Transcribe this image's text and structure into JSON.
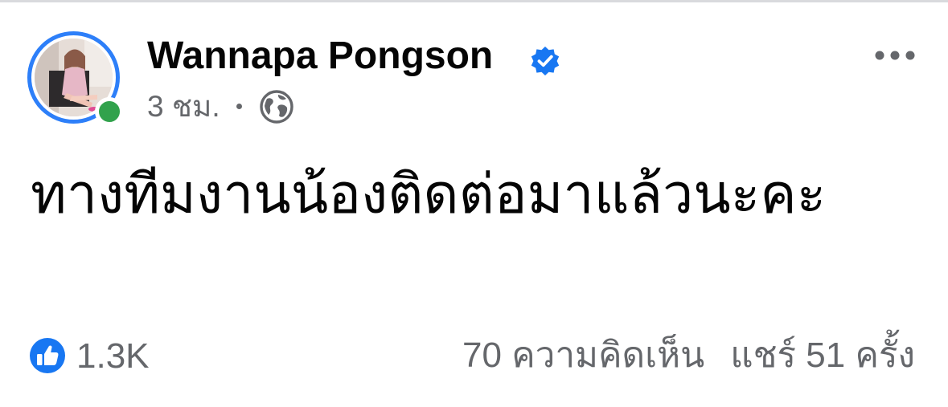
{
  "post": {
    "author_name": "Wannapa Pongson",
    "time": "3 ชม.",
    "separator": "·",
    "text": "ทางทีมงานน้องติดต่อมาแล้วนะคะ",
    "reactions_count": "1.3K",
    "comments": "70 ความคิดเห็น",
    "shares": "แชร์ 51 ครั้ง"
  },
  "icons": {
    "verified": "verified-badge-icon",
    "audience": "globe-icon",
    "more": "more-options-icon",
    "reaction": "like-icon"
  },
  "colors": {
    "brand_blue": "#1877f2",
    "online_green": "#31a24c",
    "secondary_text": "#65676b"
  }
}
